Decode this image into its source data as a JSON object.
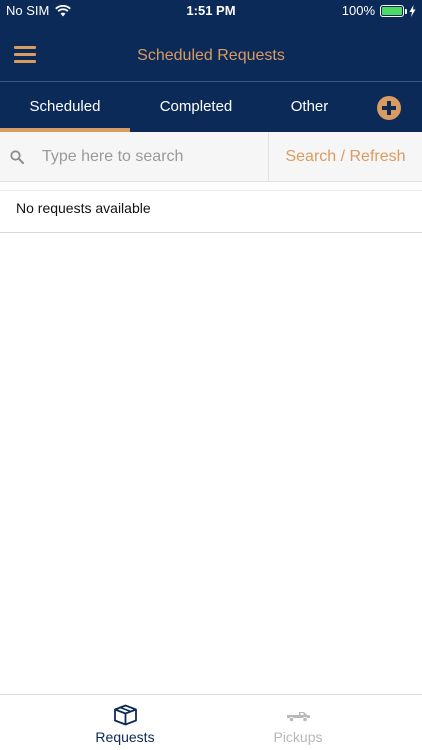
{
  "status_bar": {
    "carrier": "No SIM",
    "time": "1:51 PM",
    "battery": "100%",
    "battery_level": 1.0
  },
  "nav": {
    "title": "Scheduled Requests",
    "menu_icon": "hamburger-icon"
  },
  "tabs": [
    {
      "label": "Scheduled",
      "selected": true
    },
    {
      "label": "Completed",
      "selected": false
    },
    {
      "label": "Other",
      "selected": false
    }
  ],
  "add_button_icon": "plus-circle-icon",
  "search": {
    "placeholder": "Type here to search",
    "value": "",
    "button_label": "Search / Refresh"
  },
  "list": {
    "empty_message": "No requests available"
  },
  "bottom_tabs": [
    {
      "label": "Requests",
      "icon": "box-icon",
      "active": true
    },
    {
      "label": "Pickups",
      "icon": "truck-icon",
      "active": false
    }
  ],
  "colors": {
    "header_bg": "#0c2a57",
    "accent": "#d89b62",
    "active_tab_text": "#0c2a57",
    "inactive_tab_text": "#b8b8b8",
    "battery": "#4cd964"
  }
}
